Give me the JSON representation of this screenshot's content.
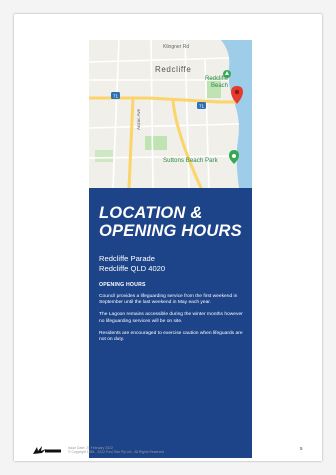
{
  "map": {
    "labels": {
      "road_top": "Klingner Rd",
      "suburb": "Redcliffe",
      "beach_line1": "Redcliffe",
      "beach_line2": "Beach",
      "park": "Suttons Beach Park",
      "avenue": "Anzac Ave",
      "route_badge": "71"
    },
    "colors": {
      "water": "#9ecdea",
      "land": "#f1efe9",
      "road": "#fbd46a",
      "park": "#bfe3b3",
      "pin": "#e53a2f"
    },
    "icons": [
      "map-pin-icon",
      "park-marker-icon",
      "tree-marker-icon",
      "route-badge-icon"
    ]
  },
  "location": {
    "title_line1": "LOCATION &",
    "title_line2": "OPENING HOURS",
    "address_line1": "Redcliffe Parade",
    "address_line2": "Redcliffe QLD 4020"
  },
  "opening_hours": {
    "heading": "OPENING HOURS",
    "paragraphs": [
      "Council provides a lifeguarding service from the first weekend in September until the last weekend in May each year.",
      "The Lagoon remains accessible during the winter months however no lifeguarding services will be on site.",
      "Residents are encouraged to exercise caution when lifeguards are not on duty."
    ]
  },
  "footer": {
    "line1": "Issue Date: 21 February 2022",
    "line2": "© Copyright 1984 - 2022 Pool Star Pty Ltd - All Rights Reserved",
    "page_number": "5",
    "logo_color": "#111111"
  },
  "theme": {
    "panel_color": "#1d4388"
  }
}
